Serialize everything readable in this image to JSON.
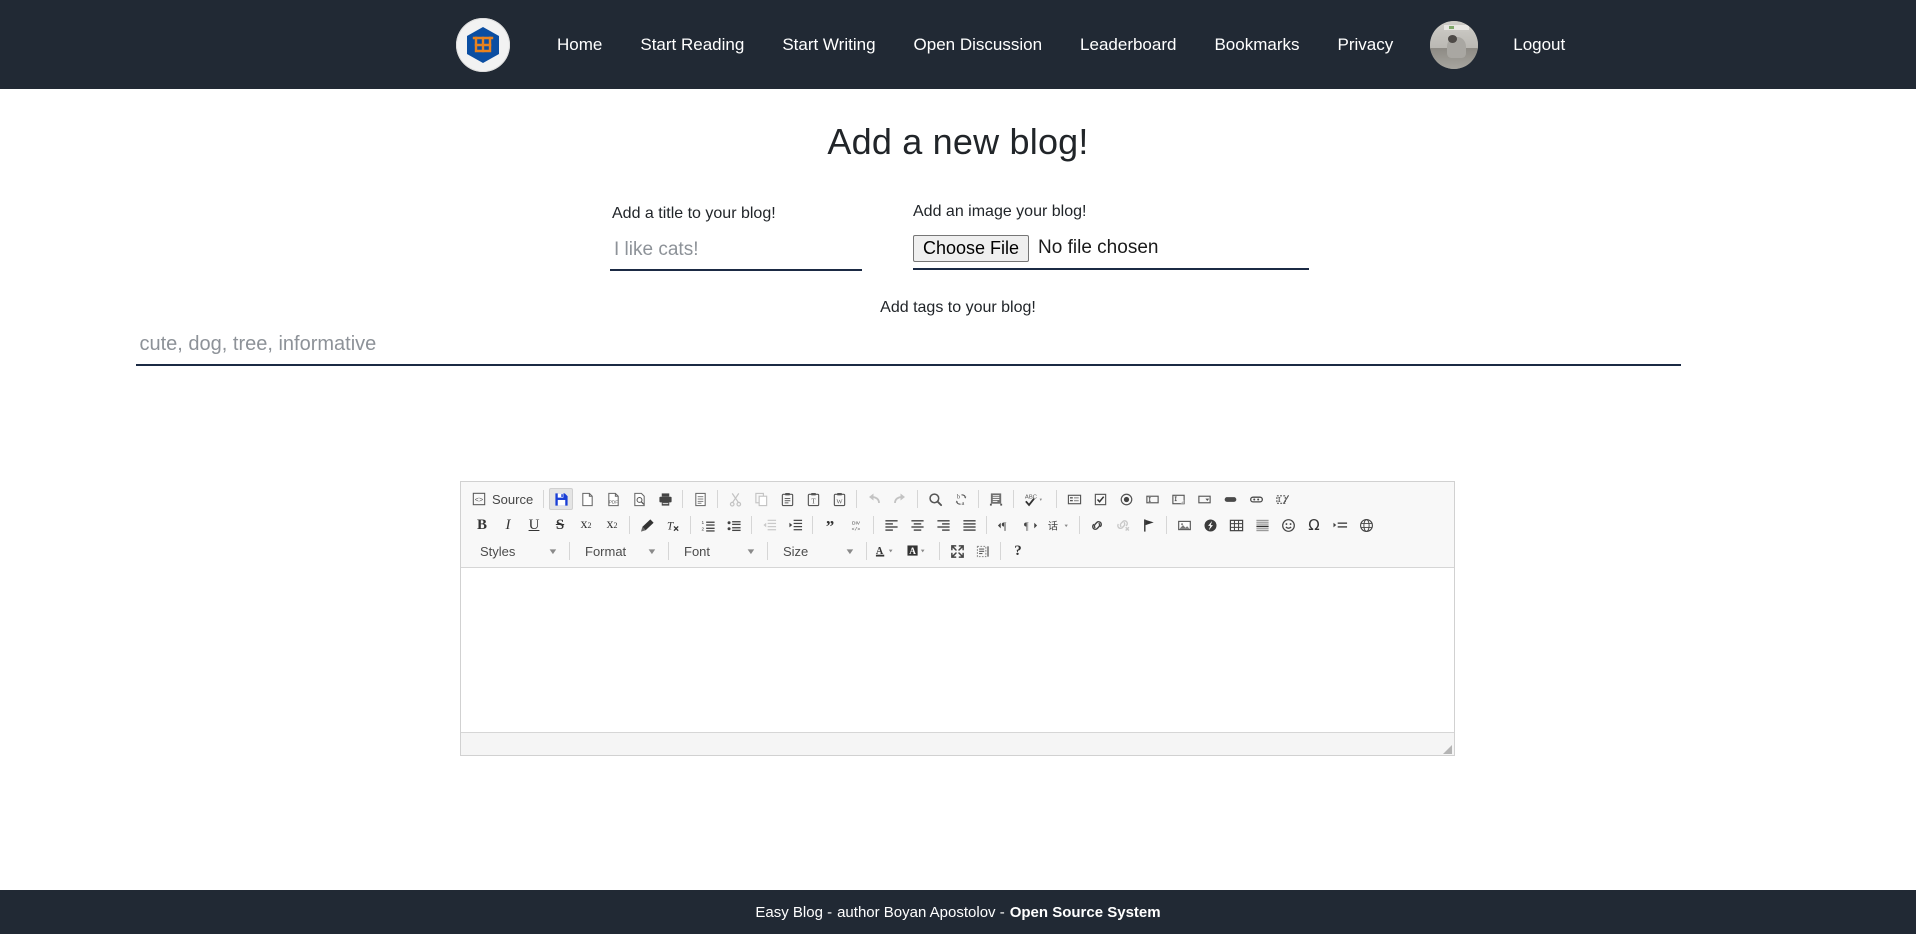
{
  "navbar": {
    "logo_icon": "shopping-cart-hexagon-logo",
    "links": [
      {
        "label": "Home",
        "name": "nav-link-home"
      },
      {
        "label": "Start Reading",
        "name": "nav-link-start-reading"
      },
      {
        "label": "Start Writing",
        "name": "nav-link-start-writing"
      },
      {
        "label": "Open Discussion",
        "name": "nav-link-open-discussion"
      },
      {
        "label": "Leaderboard",
        "name": "nav-link-leaderboard"
      },
      {
        "label": "Bookmarks",
        "name": "nav-link-bookmarks"
      },
      {
        "label": "Privacy",
        "name": "nav-link-privacy"
      }
    ],
    "avatar_alt": "user-avatar-photo",
    "logout_label": "Logout",
    "background": "#212934"
  },
  "main": {
    "page_title": "Add a new blog!",
    "title_field": {
      "label": "Add a title to your blog!",
      "placeholder": "I like cats!",
      "value": ""
    },
    "image_field": {
      "label": "Add an image your blog!",
      "button_label": "Choose File",
      "status_text": "No file chosen"
    },
    "tags_field": {
      "label": "Add tags to your blog!",
      "placeholder": "cute, dog, tree, informative",
      "value": ""
    }
  },
  "editor": {
    "source_label": "Source",
    "row1": [
      {
        "icon": "source-icon",
        "label": "Source",
        "type": "source"
      },
      {
        "type": "sep"
      },
      {
        "icon": "save-icon",
        "title": "Save",
        "state": "active"
      },
      {
        "icon": "new-page-icon",
        "title": "New Page"
      },
      {
        "icon": "export-pdf-icon",
        "title": "Export to PDF"
      },
      {
        "icon": "preview-icon",
        "title": "Preview"
      },
      {
        "icon": "print-icon",
        "title": "Print"
      },
      {
        "type": "sep"
      },
      {
        "icon": "templates-icon",
        "title": "Templates"
      },
      {
        "type": "sep"
      },
      {
        "icon": "cut-icon",
        "title": "Cut",
        "state": "dim"
      },
      {
        "icon": "copy-icon",
        "title": "Copy",
        "state": "dim"
      },
      {
        "icon": "paste-icon",
        "title": "Paste"
      },
      {
        "icon": "paste-text-icon",
        "title": "Paste as plain text"
      },
      {
        "icon": "paste-word-icon",
        "title": "Paste from Word"
      },
      {
        "type": "sep"
      },
      {
        "icon": "undo-icon",
        "title": "Undo",
        "state": "dim"
      },
      {
        "icon": "redo-icon",
        "title": "Redo",
        "state": "dim"
      },
      {
        "type": "sep"
      },
      {
        "icon": "find-icon",
        "title": "Find"
      },
      {
        "icon": "replace-icon",
        "title": "Replace"
      },
      {
        "type": "sep"
      },
      {
        "icon": "select-all-icon",
        "title": "Select All"
      },
      {
        "type": "sep"
      },
      {
        "icon": "spellcheck-icon",
        "title": "Spell Check As You Type",
        "arrow": true
      },
      {
        "type": "sep"
      },
      {
        "icon": "form-icon",
        "title": "Form"
      },
      {
        "icon": "checkbox-icon",
        "title": "Checkbox"
      },
      {
        "icon": "radio-icon",
        "title": "Radio Button"
      },
      {
        "icon": "textfield-icon",
        "title": "Text Field"
      },
      {
        "icon": "textarea-icon",
        "title": "Textarea"
      },
      {
        "icon": "selectfield-icon",
        "title": "Selection Field"
      },
      {
        "icon": "button-icon",
        "title": "Button"
      },
      {
        "icon": "imagebutton-icon",
        "title": "Image Button"
      },
      {
        "icon": "hiddenfield-icon",
        "title": "Hidden Field"
      }
    ],
    "row2": [
      {
        "icon": "bold-icon",
        "title": "Bold"
      },
      {
        "icon": "italic-icon",
        "title": "Italic"
      },
      {
        "icon": "underline-icon",
        "title": "Underline"
      },
      {
        "icon": "strike-icon",
        "title": "Strikethrough"
      },
      {
        "icon": "subscript-icon",
        "title": "Subscript"
      },
      {
        "icon": "superscript-icon",
        "title": "Superscript"
      },
      {
        "type": "sep"
      },
      {
        "icon": "copy-formatting-icon",
        "title": "Copy Formatting"
      },
      {
        "icon": "remove-format-icon",
        "title": "Remove Format"
      },
      {
        "type": "sep"
      },
      {
        "icon": "numbered-list-icon",
        "title": "Insert/Remove Numbered List"
      },
      {
        "icon": "bulleted-list-icon",
        "title": "Insert/Remove Bulleted List"
      },
      {
        "type": "sep"
      },
      {
        "icon": "outdent-icon",
        "title": "Decrease Indent",
        "state": "dim"
      },
      {
        "icon": "indent-icon",
        "title": "Increase Indent"
      },
      {
        "type": "sep"
      },
      {
        "icon": "blockquote-icon",
        "title": "Block Quote"
      },
      {
        "icon": "create-div-icon",
        "title": "Create Div Container"
      },
      {
        "type": "sep"
      },
      {
        "icon": "align-left-icon",
        "title": "Align Left"
      },
      {
        "icon": "align-center-icon",
        "title": "Center"
      },
      {
        "icon": "align-right-icon",
        "title": "Align Right"
      },
      {
        "icon": "align-justify-icon",
        "title": "Justify"
      },
      {
        "type": "sep"
      },
      {
        "icon": "ltr-icon",
        "title": "Text direction left to right"
      },
      {
        "icon": "rtl-icon",
        "title": "Text direction right to left"
      },
      {
        "icon": "language-icon",
        "title": "Set language",
        "arrow": true
      },
      {
        "type": "sep"
      },
      {
        "icon": "link-icon",
        "title": "Link"
      },
      {
        "icon": "unlink-icon",
        "title": "Unlink",
        "state": "dim"
      },
      {
        "icon": "anchor-icon",
        "title": "Anchor"
      },
      {
        "type": "sep"
      },
      {
        "icon": "image-icon",
        "title": "Image"
      },
      {
        "icon": "flash-icon",
        "title": "Flash"
      },
      {
        "icon": "table-icon",
        "title": "Table"
      },
      {
        "icon": "horizontal-rule-icon",
        "title": "Horizontal Line"
      },
      {
        "icon": "smiley-icon",
        "title": "Smiley"
      },
      {
        "icon": "special-char-icon",
        "title": "Insert Special Character"
      },
      {
        "icon": "page-break-icon",
        "title": "Page Break"
      },
      {
        "icon": "iframe-icon",
        "title": "IFrame"
      }
    ],
    "row3": [
      {
        "type": "combo",
        "label": "Styles",
        "width": "w-styles"
      },
      {
        "type": "sep"
      },
      {
        "type": "combo",
        "label": "Format",
        "width": "w-format"
      },
      {
        "type": "sep"
      },
      {
        "type": "combo",
        "label": "Font",
        "width": "w-font"
      },
      {
        "type": "sep"
      },
      {
        "type": "combo",
        "label": "Size",
        "width": "w-size"
      },
      {
        "type": "sep"
      },
      {
        "icon": "text-color-icon",
        "title": "Text Color",
        "arrow": true
      },
      {
        "icon": "bg-color-icon",
        "title": "Background Color",
        "arrow": true
      },
      {
        "type": "sep"
      },
      {
        "icon": "maximize-icon",
        "title": "Maximize"
      },
      {
        "icon": "show-blocks-icon",
        "title": "Show Blocks"
      },
      {
        "type": "sep"
      },
      {
        "icon": "about-icon",
        "title": "About CKEditor"
      }
    ],
    "content": ""
  },
  "footer": {
    "text_main": "Easy Blog -",
    "text_author": "author Boyan Apostolov -",
    "text_strong": "Open Source System",
    "background": "#212934"
  }
}
